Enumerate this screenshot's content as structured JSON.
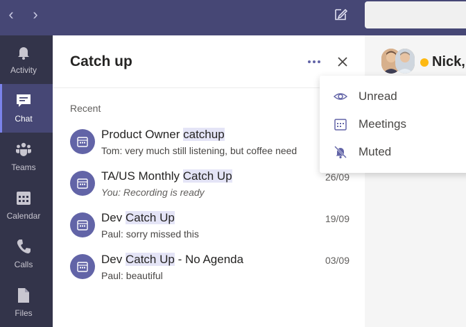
{
  "panel": {
    "title": "Catch up",
    "section": "Recent"
  },
  "rail": [
    {
      "key": "activity",
      "label": "Activity",
      "icon": "bell-icon"
    },
    {
      "key": "chat",
      "label": "Chat",
      "icon": "chat-icon",
      "active": true
    },
    {
      "key": "teams",
      "label": "Teams",
      "icon": "teams-icon"
    },
    {
      "key": "calendar",
      "label": "Calendar",
      "icon": "calendar-icon"
    },
    {
      "key": "calls",
      "label": "Calls",
      "icon": "phone-icon"
    },
    {
      "key": "files",
      "label": "Files",
      "icon": "file-icon"
    }
  ],
  "chats": [
    {
      "title_pre": "Product Owner ",
      "title_hl": "catchup",
      "title_post": "",
      "preview": "Tom: very much still listening, but coffee need",
      "date": ""
    },
    {
      "title_pre": "TA/US Monthly ",
      "title_hl": "Catch Up",
      "title_post": "",
      "preview": "You: Recording is ready",
      "date": "26/09"
    },
    {
      "title_pre": "Dev ",
      "title_hl": "Catch Up",
      "title_post": "",
      "preview": "Paul: sorry missed this",
      "date": "19/09"
    },
    {
      "title_pre": "Dev ",
      "title_hl": "Catch Up",
      "title_post": " - No Agenda",
      "preview": "Paul: beautiful",
      "date": "03/09"
    }
  ],
  "menu": [
    {
      "label": "Unread",
      "icon": "eye-icon"
    },
    {
      "label": "Meetings",
      "icon": "calendar-icon"
    },
    {
      "label": "Muted",
      "icon": "muted-bell-icon"
    }
  ],
  "chat_header": {
    "name": "Nick,"
  },
  "colors": {
    "topbar": "#464775",
    "rail": "#33344a",
    "accent": "#6264a7",
    "highlight": "#e4e4f6",
    "status": "#fdb913"
  }
}
